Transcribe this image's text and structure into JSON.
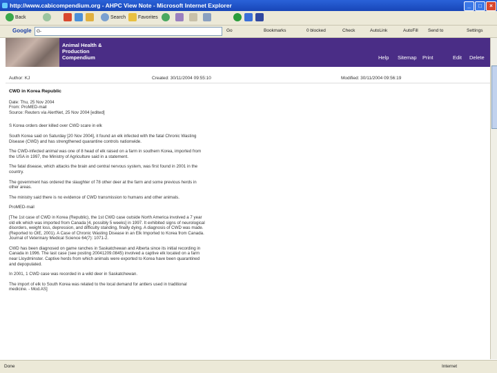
{
  "window": {
    "title": "http://www.cabicompendium.org - AHPC View Note - Microsoft Internet Explorer",
    "buttons": {
      "minimize": "_",
      "maximize": "□",
      "close": "×"
    }
  },
  "toolbar": {
    "back": "Back",
    "search": "Search",
    "favorites": "Favorites",
    "go": "Go"
  },
  "google_bar": {
    "logo": "Google",
    "search_placeholder": "G-",
    "items": [
      "Go",
      "Bookmarks",
      "0 blocked",
      "Check",
      "AutoLink",
      "AutoFill",
      "Send to",
      "Settings"
    ]
  },
  "site": {
    "brand": [
      "Animal Health &",
      "Production",
      "Compendium"
    ],
    "nav": [
      "Help",
      "Sitemap",
      "Print",
      "Edit",
      "Delete"
    ]
  },
  "meta": {
    "author": "Author: KJ",
    "created": "Created: 30/11/2004 09:55:10",
    "modified": "Modified: 30/11/2004 09:56:19"
  },
  "article": {
    "title": "CWD in Korea Republic",
    "lines": [
      "Date: Thu, 25 Nov 2004",
      "From: ProMED-mail",
      "Source: Reuters via AlertNet, 25 Nov 2004 [edited]",
      "S Korea orders deer killed over CWD scare in elk",
      "South Korea said on Saturday [20 Nov 2004], it found an elk infected with the fatal Chronic Wasting Disease (CWD) and has strengthened quarantine controls nationwide.",
      "The CWD-infected animal was one of 8 head of elk raised on a farm in southern Korea, imported from the USA in 1997, the Ministry of Agriculture said in a statement.",
      "The fatal disease, which attacks the brain and central nervous system, was first found in 2001 in the country.",
      "The government has ordered the slaughter of 78 other deer at the farm and some previous herds in other areas.",
      "The ministry said there is no evidence of CWD transmission to humans and other animals.",
      "ProMED-mail",
      "[The 1st case of CWD in Korea (Republic), the 1st CWD case outside North America involved a 7 year old elk which was imported from Canada [4, possibly 5 weeks] in 1997. It exhibited signs of neurological disorders, weight loss, depression, and difficulty standing, finally dying. A diagnosis of CWD was made. (Reported to OIE, 2001). A Case of Chronic Wasting Disease in an Elk Imported to Korea from Canada. Journal of Veterinary Medical Science 64(7): 1071-2.",
      "CWD has been diagnosed on game ranches in Saskatchewan and Alberta since its initial recording in Canada in 1996. The last case (see posting 20041209.0845) involved a captive elk located on a farm near Lloydminster. Captive herds from which animals were exported to Korea have been quarantined and depopulated.",
      "In 2001, 1 CWD case was recorded in a wild deer in Saskatchewan.",
      "The import of elk to South Korea was related to the local demand for antlers used in traditional medicine. - Mod.AS]"
    ]
  },
  "status": {
    "left": "Done",
    "right": "Internet"
  }
}
